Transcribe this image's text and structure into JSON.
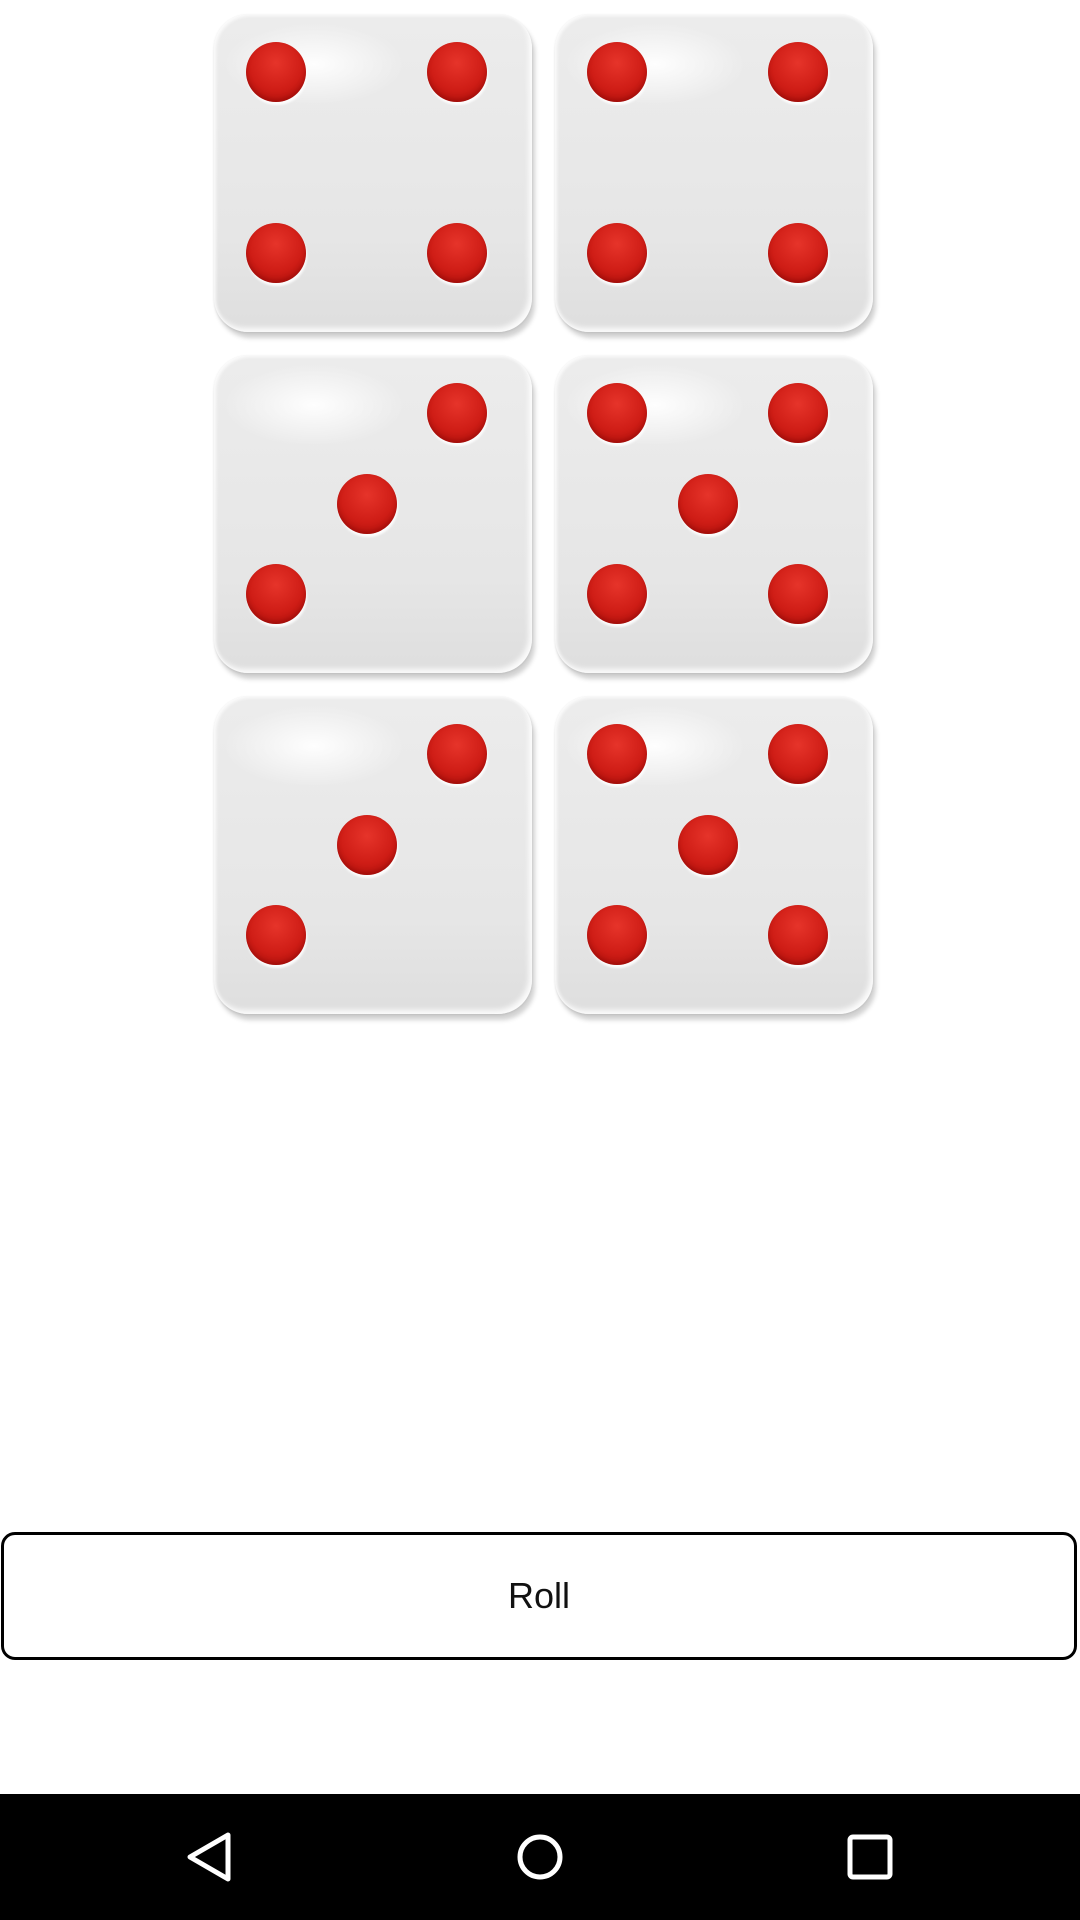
{
  "dice": [
    {
      "position": "row-1-left",
      "value": 4,
      "pip_color": "#d21f17"
    },
    {
      "position": "row-1-right",
      "value": 4,
      "pip_color": "#d21f17"
    },
    {
      "position": "row-2-left",
      "value": 3,
      "pip_color": "#d21f17"
    },
    {
      "position": "row-2-right",
      "value": 5,
      "pip_color": "#d21f17"
    },
    {
      "position": "row-3-left",
      "value": 3,
      "pip_color": "#d21f17"
    },
    {
      "position": "row-3-right",
      "value": 5,
      "pip_color": "#d21f17"
    }
  ],
  "roll_button": {
    "label": "Roll"
  },
  "nav_bar": {
    "background": "#000000",
    "buttons": [
      {
        "icon": "back-triangle-icon"
      },
      {
        "icon": "home-circle-icon"
      },
      {
        "icon": "recents-square-icon"
      }
    ]
  }
}
